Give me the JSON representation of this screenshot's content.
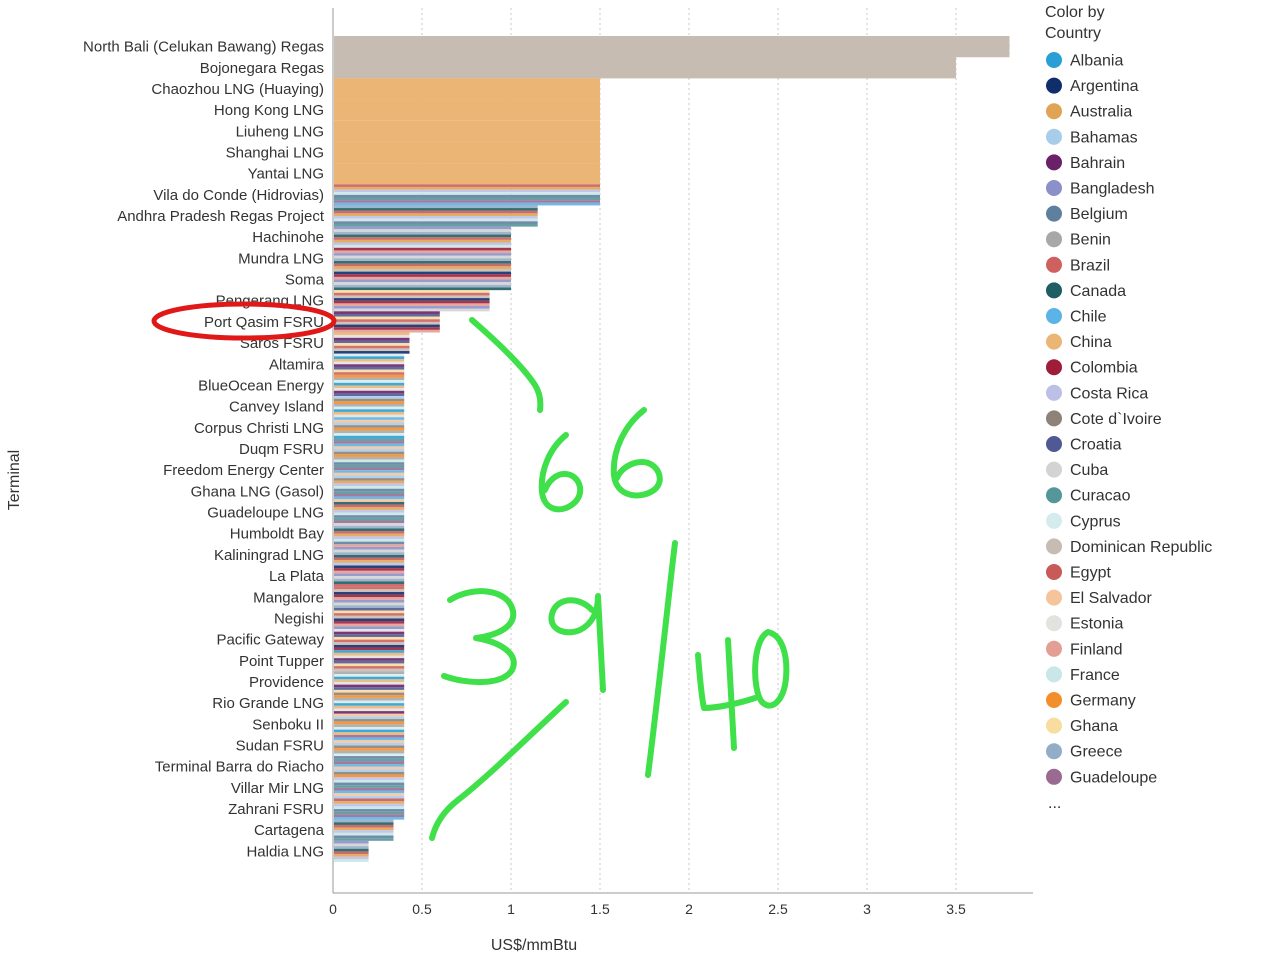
{
  "chart_data": {
    "type": "bar",
    "orientation": "horizontal",
    "xlabel": "US$/mmBtu",
    "ylabel": "Terminal",
    "xlim": [
      0,
      3.9
    ],
    "x_ticks": [
      "0",
      "0.5",
      "1",
      "1.5",
      "2",
      "2.5",
      "3",
      "3.5"
    ],
    "x_tick_values": [
      0,
      0.5,
      1,
      1.5,
      2,
      2.5,
      3,
      3.5
    ],
    "grid": true,
    "legend_title": "Color by Country",
    "legend_more": "...",
    "legend": [
      {
        "name": "Albania",
        "color": "#2a9fd6"
      },
      {
        "name": "Argentina",
        "color": "#0f2e6b"
      },
      {
        "name": "Australia",
        "color": "#e0a454"
      },
      {
        "name": "Bahamas",
        "color": "#a7cdea"
      },
      {
        "name": "Bahrain",
        "color": "#6a2168"
      },
      {
        "name": "Bangladesh",
        "color": "#8c90c8"
      },
      {
        "name": "Belgium",
        "color": "#5f7f9e"
      },
      {
        "name": "Benin",
        "color": "#a8a8a8"
      },
      {
        "name": "Brazil",
        "color": "#cf6060"
      },
      {
        "name": "Canada",
        "color": "#1c5e63"
      },
      {
        "name": "Chile",
        "color": "#5cb3e6"
      },
      {
        "name": "China",
        "color": "#ebb575"
      },
      {
        "name": "Colombia",
        "color": "#9e1e3a"
      },
      {
        "name": "Costa Rica",
        "color": "#bdc0e6"
      },
      {
        "name": "Cote d`Ivoire",
        "color": "#8e8278"
      },
      {
        "name": "Croatia",
        "color": "#4f5a94"
      },
      {
        "name": "Cuba",
        "color": "#d3d3d3"
      },
      {
        "name": "Curacao",
        "color": "#55969a"
      },
      {
        "name": "Cyprus",
        "color": "#d5ecee"
      },
      {
        "name": "Dominican Republic",
        "color": "#c7bcb2"
      },
      {
        "name": "Egypt",
        "color": "#c85a5a"
      },
      {
        "name": "El Salvador",
        "color": "#f5c49b"
      },
      {
        "name": "Estonia",
        "color": "#e2e2df"
      },
      {
        "name": "Finland",
        "color": "#e39f93"
      },
      {
        "name": "France",
        "color": "#c9e7e8"
      },
      {
        "name": "Germany",
        "color": "#f28e2b"
      },
      {
        "name": "Ghana",
        "color": "#f9dca0"
      },
      {
        "name": "Greece",
        "color": "#93adc8"
      },
      {
        "name": "Guadeloupe",
        "color": "#9b6a93"
      }
    ],
    "categories": [
      "North Bali (Celukan Bawang) Regas",
      "Bojonegara Regas",
      "Chaozhou LNG (Huaying)",
      "Hong Kong LNG",
      "Liuheng LNG",
      "Shanghai LNG",
      "Yantai LNG",
      "Vila do Conde (Hidrovias)",
      "Andhra Pradesh Regas Project",
      "Hachinohe",
      "Mundra LNG",
      "Soma",
      "Pengerang LNG",
      "Port Qasim FSRU",
      "Saros FSRU",
      "Altamira",
      "BlueOcean Energy",
      "Canvey Island",
      "Corpus Christi LNG",
      "Duqm FSRU",
      "Freedom Energy Center",
      "Ghana LNG (Gasol)",
      "Guadeloupe LNG",
      "Humboldt Bay",
      "Kaliningrad LNG",
      "La Plata",
      "Mangalore",
      "Negishi",
      "Pacific Gateway",
      "Point Tupper",
      "Providence",
      "Rio Grande LNG",
      "Senboku II",
      "Sudan FSRU",
      "Terminal Barra do Riacho",
      "Villar Mir LNG",
      "Zahrani FSRU",
      "Cartagena",
      "Haldia LNG"
    ],
    "values": [
      3.8,
      3.5,
      1.5,
      1.5,
      1.5,
      1.5,
      1.5,
      1.5,
      1.15,
      1.0,
      1.0,
      1.0,
      0.88,
      0.6,
      0.43,
      0.4,
      0.4,
      0.4,
      0.4,
      0.4,
      0.4,
      0.4,
      0.4,
      0.4,
      0.4,
      0.4,
      0.4,
      0.4,
      0.4,
      0.4,
      0.4,
      0.4,
      0.4,
      0.4,
      0.4,
      0.4,
      0.4,
      0.34,
      0.2
    ]
  },
  "annotations": {
    "circled_label": "Port Qasim FSRU",
    "handwritten": [
      "66",
      "39",
      "40"
    ]
  }
}
